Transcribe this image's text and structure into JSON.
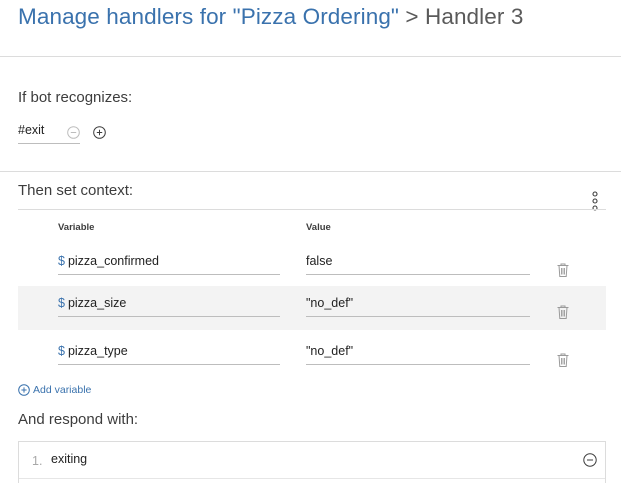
{
  "header": {
    "bot_link": "Manage handlers for \"Pizza Ordering\"",
    "separator": ">",
    "current": "Handler 3"
  },
  "condition": {
    "label": "If bot recognizes:",
    "value": "#exit"
  },
  "context": {
    "label": "Then set context:",
    "columns": {
      "variable": "Variable",
      "value": "Value"
    },
    "rows": [
      {
        "prefix": "$",
        "variable": "pizza_confirmed",
        "value": "false"
      },
      {
        "prefix": "$",
        "variable": "pizza_size",
        "value": "\"no_def\""
      },
      {
        "prefix": "$",
        "variable": "pizza_type",
        "value": "\"no_def\""
      }
    ],
    "add_label": "Add variable"
  },
  "response": {
    "label": "And respond with:",
    "items": [
      {
        "number": "1.",
        "text": "exiting"
      }
    ]
  },
  "colors": {
    "accent": "#3a72ad",
    "row_shade": "#f3f3f3",
    "divider": "#dcdcdc"
  },
  "icons": {
    "remove_condition": "minus-circle-icon",
    "add_condition": "plus-circle-icon",
    "more_options": "overflow-menu-icon",
    "delete_row": "trash-icon",
    "add_variable": "plus-circle-icon",
    "remove_response": "minus-circle-icon"
  }
}
